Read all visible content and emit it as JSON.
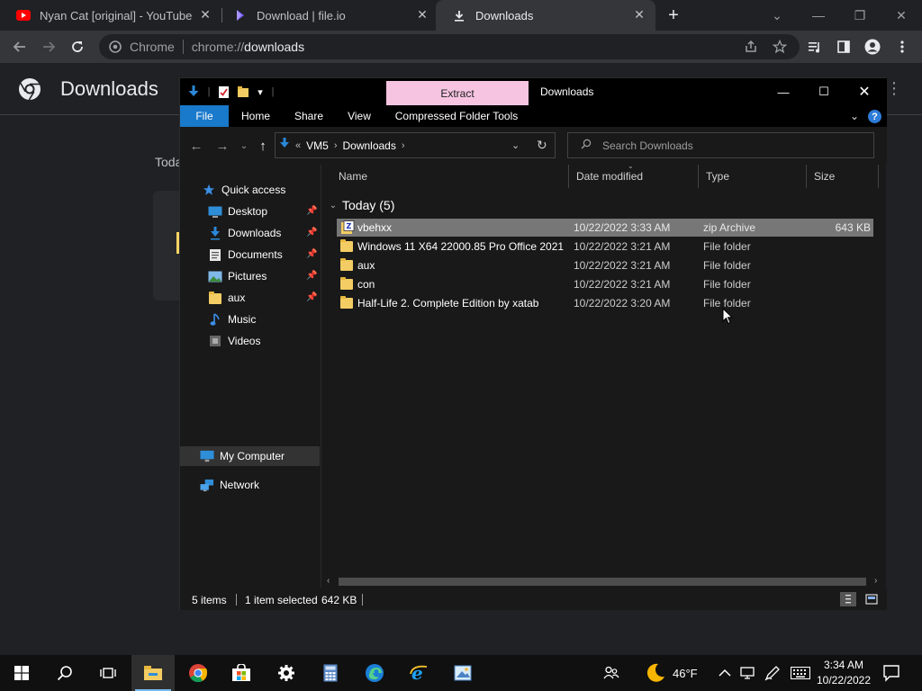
{
  "chrome": {
    "tabs": [
      {
        "title": "Nyan Cat [original] - YouTube",
        "icon": "youtube-icon"
      },
      {
        "title": "Download | file.io",
        "icon": "fileio-icon"
      },
      {
        "title": "Downloads",
        "icon": "download-icon",
        "active": true
      }
    ],
    "omnibox": {
      "chip": "Chrome",
      "url_prefix": "chrome://",
      "url_host": "downloads"
    }
  },
  "downloads_page": {
    "title": "Downloads",
    "section": "Toda"
  },
  "explorer": {
    "window_title": "Downloads",
    "context_tab": "Extract",
    "ribbon_tabs": [
      "File",
      "Home",
      "Share",
      "View",
      "Compressed Folder Tools"
    ],
    "address": {
      "overflow": "«",
      "path": [
        "VM5",
        "Downloads"
      ]
    },
    "search_placeholder": "Search Downloads",
    "nav": [
      {
        "label": "Quick access",
        "icon": "star-icon",
        "level": 0
      },
      {
        "label": "Desktop",
        "icon": "desktop-icon",
        "level": 1,
        "pinned": true
      },
      {
        "label": "Downloads",
        "icon": "download-arrow-icon",
        "level": 1,
        "pinned": true
      },
      {
        "label": "Documents",
        "icon": "documents-icon",
        "level": 1,
        "pinned": true
      },
      {
        "label": "Pictures",
        "icon": "pictures-icon",
        "level": 1,
        "pinned": true
      },
      {
        "label": "aux",
        "icon": "folder-icon",
        "level": 1,
        "pinned": true
      },
      {
        "label": "Music",
        "icon": "music-icon",
        "level": 1
      },
      {
        "label": "Videos",
        "icon": "videos-icon",
        "level": 1
      },
      {
        "label": "My Computer",
        "icon": "computer-icon",
        "level": 0,
        "selected": true
      },
      {
        "label": "Network",
        "icon": "network-icon",
        "level": 0
      }
    ],
    "columns": [
      "Name",
      "Date modified",
      "Type",
      "Size"
    ],
    "group_label": "Today (5)",
    "files": [
      {
        "name": "vbehxx",
        "date": "10/22/2022 3:33 AM",
        "type": "zip Archive",
        "size": "643 KB",
        "kind": "zip",
        "selected": true
      },
      {
        "name": "Windows 11 X64 22000.85 Pro Office 2021...",
        "date": "10/22/2022 3:21 AM",
        "type": "File folder",
        "size": "",
        "kind": "folder"
      },
      {
        "name": "aux",
        "date": "10/22/2022 3:21 AM",
        "type": "File folder",
        "size": "",
        "kind": "folder"
      },
      {
        "name": "con",
        "date": "10/22/2022 3:21 AM",
        "type": "File folder",
        "size": "",
        "kind": "folder"
      },
      {
        "name": "Half-Life 2. Complete Edition by xatab",
        "date": "10/22/2022 3:20 AM",
        "type": "File folder",
        "size": "",
        "kind": "folder"
      }
    ],
    "status": {
      "items": "5 items",
      "selected": "1 item selected",
      "size": "642 KB"
    }
  },
  "taskbar": {
    "apps": [
      "start-icon",
      "search-icon",
      "task-view-icon",
      "file-explorer-icon",
      "chrome-icon",
      "store-icon",
      "settings-icon",
      "calculator-icon",
      "edge-icon",
      "internet-explorer-icon",
      "paint-icon"
    ],
    "weather": "46°F",
    "time": "3:34 AM",
    "date": "10/22/2022"
  },
  "colors": {
    "file_tab": "#1979ca",
    "extract_tab": "#f6c4e1",
    "selection": "#777777",
    "folder": "#f3cd63"
  }
}
